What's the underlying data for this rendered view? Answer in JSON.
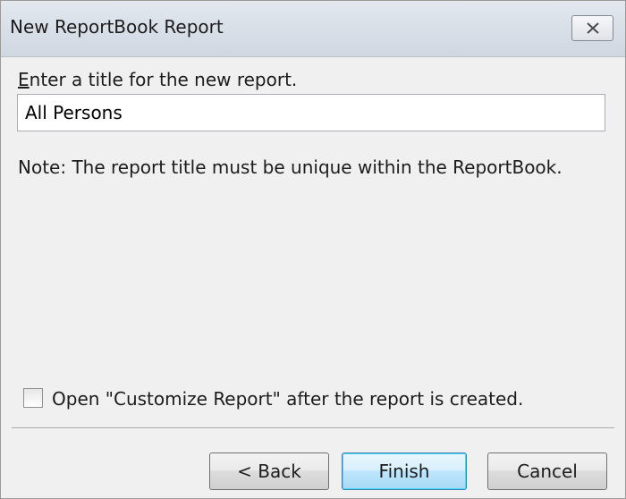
{
  "window": {
    "title": "New ReportBook Report",
    "close_icon": "close-icon"
  },
  "form": {
    "prompt_access_key": "E",
    "prompt_rest": "nter a title for the new report.",
    "title_value": "All Persons",
    "note": "Note:  The report title must be unique within the ReportBook.",
    "open_customize_label": "Open \"Customize Report\" after the report is created.",
    "open_customize_checked": false
  },
  "buttons": {
    "back_label": "< Back",
    "finish_label": "Finish",
    "cancel_label": "Cancel"
  },
  "colors": {
    "dialog_background": "#f0f0f0",
    "default_button_border": "#3c7fb1"
  }
}
